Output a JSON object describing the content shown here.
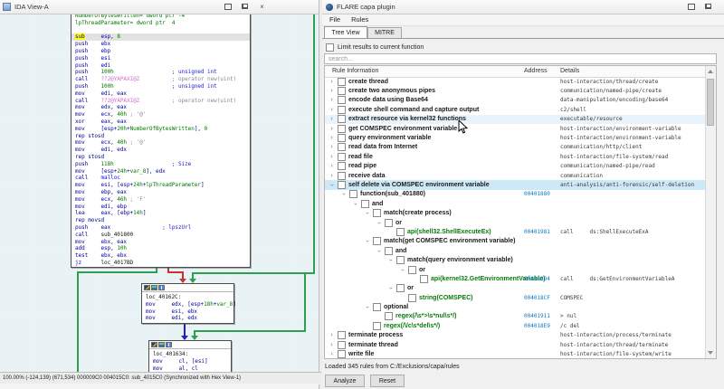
{
  "colors": {
    "selection_blue": "#cde8f6",
    "hover_blue": "#e8f3fb",
    "address_blue": "#0a78c8",
    "feature_green": "#0a7a0a",
    "asm_instruction_navy": "#00009b",
    "asm_number_green": "#007800",
    "asm_import_pink": "#cf6fcf",
    "highlight_yellow": "#ffff00",
    "edge_green": "#2e9e4f",
    "edge_red": "#c83232",
    "edge_blue": "#2020c0",
    "graph_background": "#e9f3f5"
  },
  "ida": {
    "pane_title": "IDA View-A",
    "status": "100.00% (-124,139) (671,534) 000009C0 004015C0: sub_4015C0 (Synchronized with Hex View-1)",
    "blocks": [
      {
        "id": "main",
        "lines": [
          {
            "s": [
              [
                "NumberOfBytesWritten= dword ptr -4",
                "g"
              ]
            ]
          },
          {
            "s": [
              [
                "lpThreadParameter= dword ptr  4",
                "g"
              ]
            ]
          },
          {
            "s": [
              [
                "",
                "i"
              ]
            ]
          },
          {
            "hl": true,
            "s": [
              [
                "sub",
                "hly"
              ],
              [
                "     esp, ",
                "i"
              ],
              [
                "8",
                "n"
              ]
            ]
          },
          {
            "s": [
              [
                "push    ebx",
                "i"
              ]
            ]
          },
          {
            "s": [
              [
                "push    ebp",
                "i"
              ]
            ]
          },
          {
            "s": [
              [
                "push    esi",
                "i"
              ]
            ]
          },
          {
            "s": [
              [
                "push    edi",
                "i"
              ]
            ]
          },
          {
            "s": [
              [
                "push    ",
                "i"
              ],
              [
                "100h",
                "n"
              ],
              [
                "                  ",
                "i"
              ],
              [
                "; unsigned int",
                "cb"
              ]
            ]
          },
          {
            "s": [
              [
                "call    ",
                "i"
              ],
              [
                "??2@YAPAXI@Z",
                "imp"
              ],
              [
                "          ",
                "i"
              ],
              [
                "; operator new(uint)",
                "cg"
              ]
            ]
          },
          {
            "s": [
              [
                "push    ",
                "i"
              ],
              [
                "100h",
                "n"
              ],
              [
                "                  ",
                "i"
              ],
              [
                "; unsigned int",
                "cb"
              ]
            ]
          },
          {
            "s": [
              [
                "mov     edi, eax",
                "i"
              ]
            ]
          },
          {
            "s": [
              [
                "call    ",
                "i"
              ],
              [
                "??2@YAPAXI@Z",
                "imp"
              ],
              [
                "          ",
                "i"
              ],
              [
                "; operator new(uint)",
                "cg"
              ]
            ]
          },
          {
            "s": [
              [
                "mov     edx, eax",
                "i"
              ]
            ]
          },
          {
            "s": [
              [
                "mov     ecx, ",
                "i"
              ],
              [
                "40h",
                "n"
              ],
              [
                " ; '@'",
                "cg"
              ]
            ]
          },
          {
            "s": [
              [
                "xor     eax, eax",
                "i"
              ]
            ]
          },
          {
            "s": [
              [
                "mov     [esp+",
                "i"
              ],
              [
                "20h",
                "n"
              ],
              [
                "+",
                "i"
              ],
              [
                "NumberOfBytesWritten",
                "g"
              ],
              [
                "], ",
                "i"
              ],
              [
                "0",
                "n"
              ]
            ]
          },
          {
            "s": [
              [
                "rep stosd",
                "i"
              ]
            ]
          },
          {
            "s": [
              [
                "mov     ecx, ",
                "i"
              ],
              [
                "40h",
                "n"
              ],
              [
                " ; '@'",
                "cg"
              ]
            ]
          },
          {
            "s": [
              [
                "mov     edi, edx",
                "i"
              ]
            ]
          },
          {
            "s": [
              [
                "rep stosd",
                "i"
              ]
            ]
          },
          {
            "s": [
              [
                "push    ",
                "i"
              ],
              [
                "118h",
                "n"
              ],
              [
                "                  ",
                "i"
              ],
              [
                "; Size",
                "cb"
              ]
            ]
          },
          {
            "s": [
              [
                "mov     [esp+",
                "i"
              ],
              [
                "24h",
                "n"
              ],
              [
                "+",
                "i"
              ],
              [
                "var_8",
                "g"
              ],
              [
                "], edx",
                "i"
              ]
            ]
          },
          {
            "s": [
              [
                "call    ",
                "i"
              ],
              [
                "malloc",
                "lib"
              ]
            ]
          },
          {
            "s": [
              [
                "mov     esi, [esp+",
                "i"
              ],
              [
                "24h",
                "n"
              ],
              [
                "+",
                "i"
              ],
              [
                "lpThreadParameter",
                "g"
              ],
              [
                "]",
                "i"
              ]
            ]
          },
          {
            "s": [
              [
                "mov     ebp, eax",
                "i"
              ]
            ]
          },
          {
            "s": [
              [
                "mov     ecx, ",
                "i"
              ],
              [
                "46h",
                "n"
              ],
              [
                " ; 'F'",
                "cg"
              ]
            ]
          },
          {
            "s": [
              [
                "mov     edi, ebp",
                "i"
              ]
            ]
          },
          {
            "s": [
              [
                "lea     eax, [ebp+",
                "i"
              ],
              [
                "14h",
                "n"
              ],
              [
                "]",
                "i"
              ]
            ]
          },
          {
            "s": [
              [
                "rep movsd",
                "i"
              ]
            ]
          },
          {
            "s": [
              [
                "push    eax                ",
                "i"
              ],
              [
                "; lpszUrl",
                "cb"
              ]
            ]
          },
          {
            "s": [
              [
                "call    ",
                "i"
              ],
              [
                "sub_401800",
                "k"
              ]
            ]
          },
          {
            "s": [
              [
                "mov     ebx, eax",
                "i"
              ]
            ]
          },
          {
            "s": [
              [
                "add     esp, ",
                "i"
              ],
              [
                "10h",
                "n"
              ]
            ]
          },
          {
            "s": [
              [
                "test    ebx, ebx",
                "i"
              ]
            ]
          },
          {
            "s": [
              [
                "jz      ",
                "i"
              ],
              [
                "loc_4017BD",
                "k"
              ]
            ]
          }
        ]
      },
      {
        "id": "b2",
        "lines": [
          {
            "s": [
              [
                "loc_40162C:",
                "k"
              ]
            ]
          },
          {
            "s": [
              [
                "mov     edx, [esp+",
                "i"
              ],
              [
                "18h",
                "n"
              ],
              [
                "+",
                "i"
              ],
              [
                "var_8",
                "g"
              ],
              [
                "]",
                "i"
              ]
            ]
          },
          {
            "s": [
              [
                "mov     esi, ebx",
                "i"
              ]
            ]
          },
          {
            "s": [
              [
                "mov     edi, edx",
                "i"
              ]
            ]
          }
        ]
      },
      {
        "id": "b3",
        "lines": [
          {
            "s": [
              [
                "loc_401634:",
                "k"
              ]
            ]
          },
          {
            "s": [
              [
                "mov     cl, [esi]",
                "i"
              ]
            ]
          },
          {
            "s": [
              [
                "mov     al, cl",
                "i"
              ]
            ]
          }
        ]
      }
    ]
  },
  "capa": {
    "title": "FLARE capa plugin",
    "menu": [
      "File",
      "Rules"
    ],
    "tabs": [
      "Tree View",
      "MITRE"
    ],
    "limit_label": "Limit results to current function",
    "search_placeholder": "search...",
    "columns": [
      "Rule Information",
      "Address",
      "Details"
    ],
    "status": "Loaded 345 rules from C:/Exclusions/capa/rules",
    "analyze_label": "Analyze",
    "reset_label": "Reset",
    "rows": [
      {
        "lvl": 0,
        "chev": ">",
        "label": "create thread",
        "det": "host-interaction/thread/create"
      },
      {
        "lvl": 0,
        "chev": ">",
        "label": "create two anonymous pipes",
        "det": "communication/named-pipe/create"
      },
      {
        "lvl": 0,
        "chev": ">",
        "label": "encode data using Base64",
        "det": "data-manipulation/encoding/base64"
      },
      {
        "lvl": 0,
        "chev": ">",
        "label": "execute shell command and capture output",
        "det": "c2/shell"
      },
      {
        "lvl": 0,
        "chev": ">",
        "label": "extract resource via kernel32 functions",
        "det": "executable/resource",
        "hl": "hov"
      },
      {
        "lvl": 0,
        "chev": ">",
        "label": "get COMSPEC environment variable",
        "det": "host-interaction/environment-variable"
      },
      {
        "lvl": 0,
        "chev": ">",
        "label": "query environment variable",
        "det": "host-interaction/environment-variable"
      },
      {
        "lvl": 0,
        "chev": ">",
        "label": "read data from Internet",
        "det": "communication/http/client"
      },
      {
        "lvl": 0,
        "chev": ">",
        "label": "read file",
        "det": "host-interaction/file-system/read"
      },
      {
        "lvl": 0,
        "chev": ">",
        "label": "read pipe",
        "det": "communication/named-pipe/read"
      },
      {
        "lvl": 0,
        "chev": ">",
        "label": "receive data",
        "det": "communication"
      },
      {
        "lvl": 0,
        "chev": "v",
        "label": "self delete via COMSPEC environment variable",
        "det": "anti-analysis/anti-forensic/self-deletion",
        "hl": "sel"
      },
      {
        "lvl": 1,
        "chev": "v",
        "label": "function(sub_401880)",
        "addr": "00401880"
      },
      {
        "lvl": 2,
        "chev": "v",
        "label": "and"
      },
      {
        "lvl": 3,
        "chev": "v",
        "label": "match(create process)"
      },
      {
        "lvl": 4,
        "chev": "v",
        "label": "or"
      },
      {
        "lvl": 5,
        "chev": "",
        "label": "api(shell32.ShellExecuteEx)",
        "cls": "green",
        "addr": "00401981",
        "det": "call     ds:ShellExecuteExA"
      },
      {
        "lvl": 3,
        "chev": "v",
        "label": "match(get COMSPEC environment variable)"
      },
      {
        "lvl": 4,
        "chev": "v",
        "label": "and"
      },
      {
        "lvl": 5,
        "chev": "v",
        "label": "match(query environment variable)"
      },
      {
        "lvl": 6,
        "chev": "v",
        "label": "or"
      },
      {
        "lvl": 7,
        "chev": "",
        "label": "api(kernel32.GetEnvironmentVariable)",
        "cls": "green",
        "addr": "004018D4",
        "det": "call     ds:GetEnvironmentVariableA"
      },
      {
        "lvl": 5,
        "chev": "v",
        "label": "or"
      },
      {
        "lvl": 6,
        "chev": "",
        "label": "string(COMSPEC)",
        "cls": "green",
        "addr": "004018CF",
        "det": "COMSPEC"
      },
      {
        "lvl": 3,
        "chev": "v",
        "label": "optional"
      },
      {
        "lvl": 4,
        "chev": "",
        "label": "regex(/\\s*>\\s*nul\\s*/)",
        "cls": "green",
        "addr": "00401911",
        "det": "> nul"
      },
      {
        "lvl": 3,
        "chev": "",
        "label": "regex(/\\/c\\s*del\\s*/)",
        "cls": "green",
        "addr": "004018E9",
        "det": "/c del"
      },
      {
        "lvl": 0,
        "chev": ">",
        "label": "terminate process",
        "det": "host-interaction/process/terminate"
      },
      {
        "lvl": 0,
        "chev": ">",
        "label": "terminate thread",
        "det": "host-interaction/thread/terminate"
      },
      {
        "lvl": 0,
        "chev": ">",
        "label": "write file",
        "det": "host-interaction/file-system/write"
      }
    ]
  }
}
